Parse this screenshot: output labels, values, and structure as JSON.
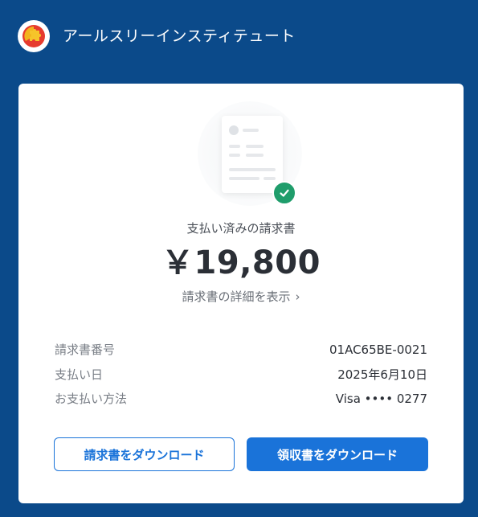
{
  "header": {
    "company_name": "アールスリーインスティテュート",
    "logo_icon": "puzzle-logo-icon"
  },
  "invoice": {
    "status_label": "支払い済みの請求書",
    "amount": "￥19,800",
    "details_link": "請求書の詳細を表示",
    "details_chevron": "›"
  },
  "info": [
    {
      "label": "請求書番号",
      "value": "01AC65BE-0021"
    },
    {
      "label": "支払い日",
      "value": "2025年6月10日"
    },
    {
      "label": "お支払い方法",
      "value": "Visa •••• 0277"
    }
  ],
  "actions": {
    "download_invoice": "請求書をダウンロード",
    "download_receipt": "領収書をダウンロード"
  },
  "colors": {
    "background": "#0b4a8a",
    "accent": "#1a73d9",
    "success": "#1f9d6b"
  }
}
